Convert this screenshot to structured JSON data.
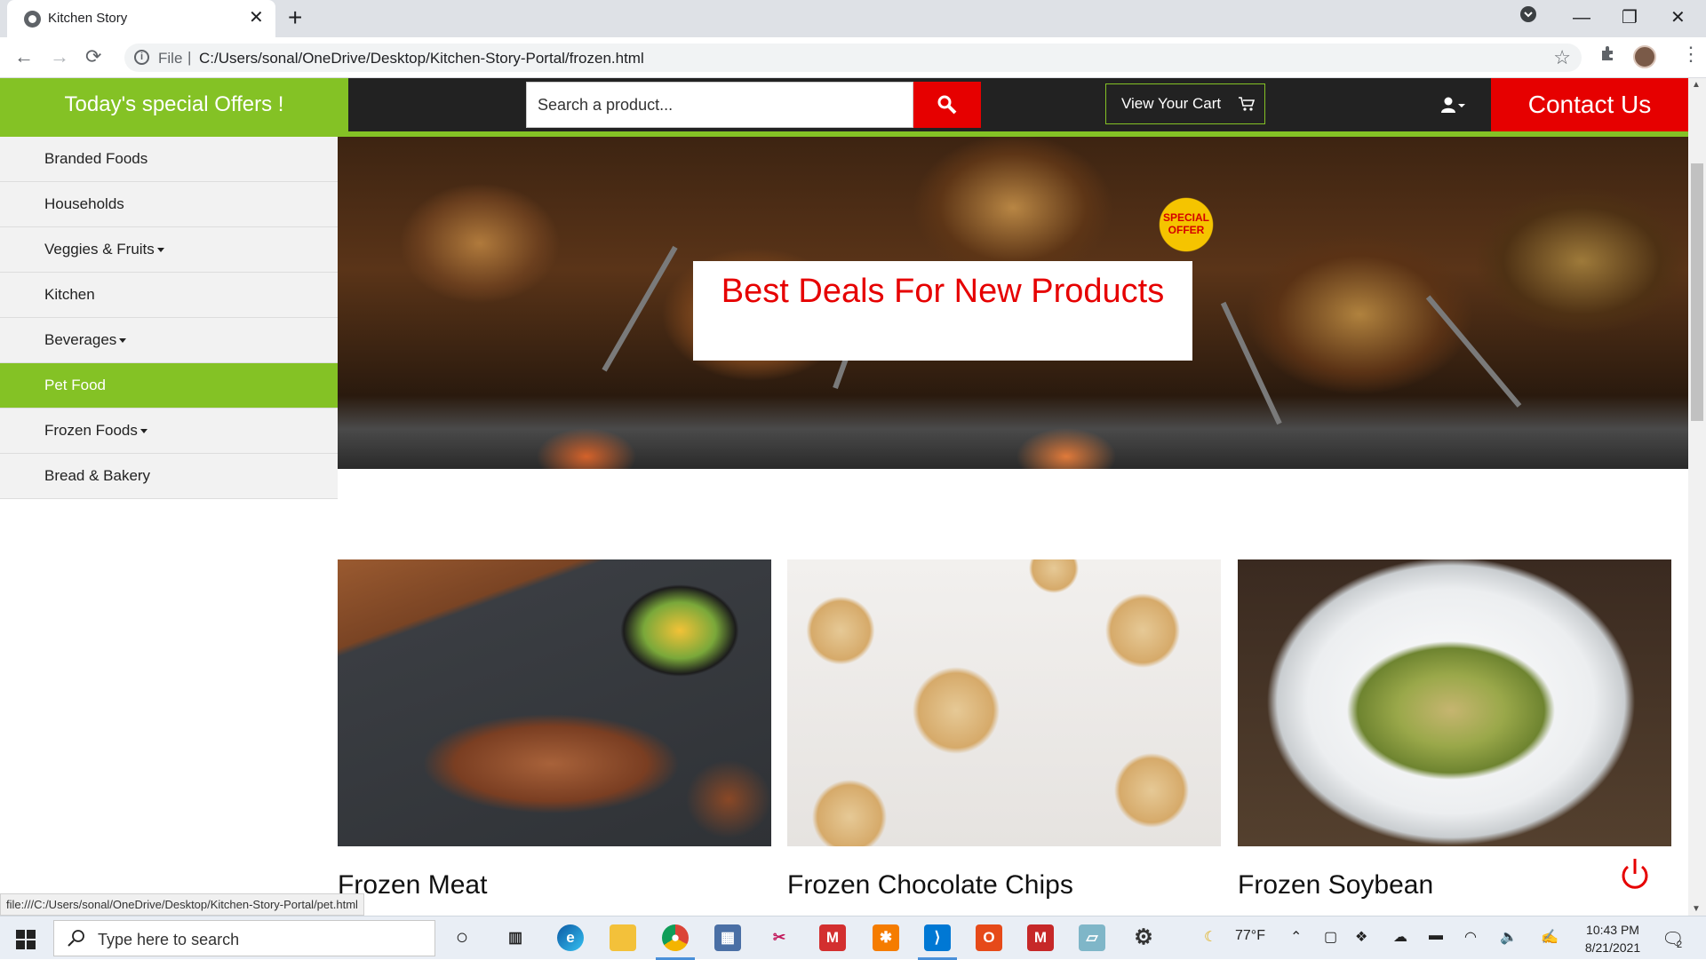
{
  "browser": {
    "tab_title": "Kitchen Story",
    "tab_close": "✕",
    "new_tab": "+",
    "file_label": "File",
    "url": "C:/Users/sonal/OneDrive/Desktop/Kitchen-Story-Portal/frozen.html",
    "status_url": "file:///C:/Users/sonal/OneDrive/Desktop/Kitchen-Story-Portal/pet.html"
  },
  "header": {
    "offers": "Today's special Offers !",
    "search_placeholder": "Search a product...",
    "cart_label": "View Your Cart",
    "contact": "Contact Us"
  },
  "sidebar": {
    "items": [
      {
        "label": "Branded Foods",
        "dropdown": false
      },
      {
        "label": "Households",
        "dropdown": false
      },
      {
        "label": "Veggies & Fruits",
        "dropdown": true
      },
      {
        "label": "Kitchen",
        "dropdown": false
      },
      {
        "label": "Beverages",
        "dropdown": true
      },
      {
        "label": "Pet Food",
        "dropdown": false,
        "active": true
      },
      {
        "label": "Frozen Foods",
        "dropdown": true
      },
      {
        "label": "Bread & Bakery",
        "dropdown": false
      }
    ]
  },
  "hero": {
    "heading": "Best Deals For New Products",
    "badge": "SPECIAL OFFER"
  },
  "products": [
    {
      "title": "Frozen Meat"
    },
    {
      "title": "Frozen Chocolate Chips"
    },
    {
      "title": "Frozen Soybean"
    }
  ],
  "taskbar": {
    "search_placeholder": "Type here to search",
    "weather": "77°F",
    "time": "10:43 PM",
    "date": "8/21/2021",
    "notification_count": "2"
  },
  "colors": {
    "brand_green": "#84c225",
    "brand_red": "#e60000",
    "topbar_dark": "#222222"
  }
}
